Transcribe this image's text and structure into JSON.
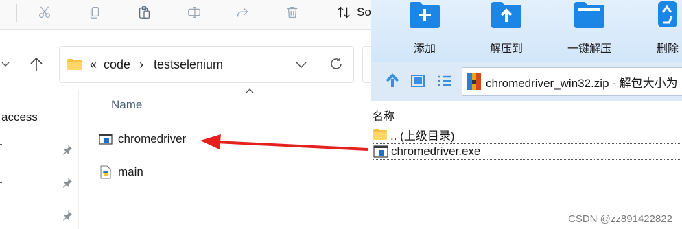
{
  "explorer": {
    "toolbar": {
      "icons": [
        "cut-icon",
        "copy-icon",
        "paste-icon",
        "rename-icon",
        "share-icon",
        "delete-icon"
      ],
      "sort_label": "So"
    },
    "address": {
      "overflow": "«",
      "segments": [
        "code",
        "testselenium"
      ],
      "separator": "›"
    },
    "nav_pane": {
      "quick_access": "access"
    },
    "list": {
      "column_name": "Name",
      "files": [
        {
          "name": "chromedriver",
          "icon": "exe-icon"
        },
        {
          "name": "main",
          "icon": "python-file-icon"
        }
      ]
    }
  },
  "zip_window": {
    "toolbar": [
      {
        "label": "添加",
        "icon": "add-icon"
      },
      {
        "label": "解压到",
        "icon": "extract-to-icon"
      },
      {
        "label": "一键解压",
        "icon": "one-click-extract-icon"
      },
      {
        "label": "删除",
        "icon": "delete-icon"
      }
    ],
    "path": "chromedriver_win32.zip - 解包大小为",
    "column_name": "名称",
    "rows": [
      {
        "name": ".. (上级目录)",
        "icon": "folder-icon"
      },
      {
        "name": "chromedriver.exe",
        "icon": "exe-icon"
      }
    ]
  },
  "annotation": {
    "arrow_color": "#e5211d"
  },
  "watermark": "CSDN @zz891422822"
}
